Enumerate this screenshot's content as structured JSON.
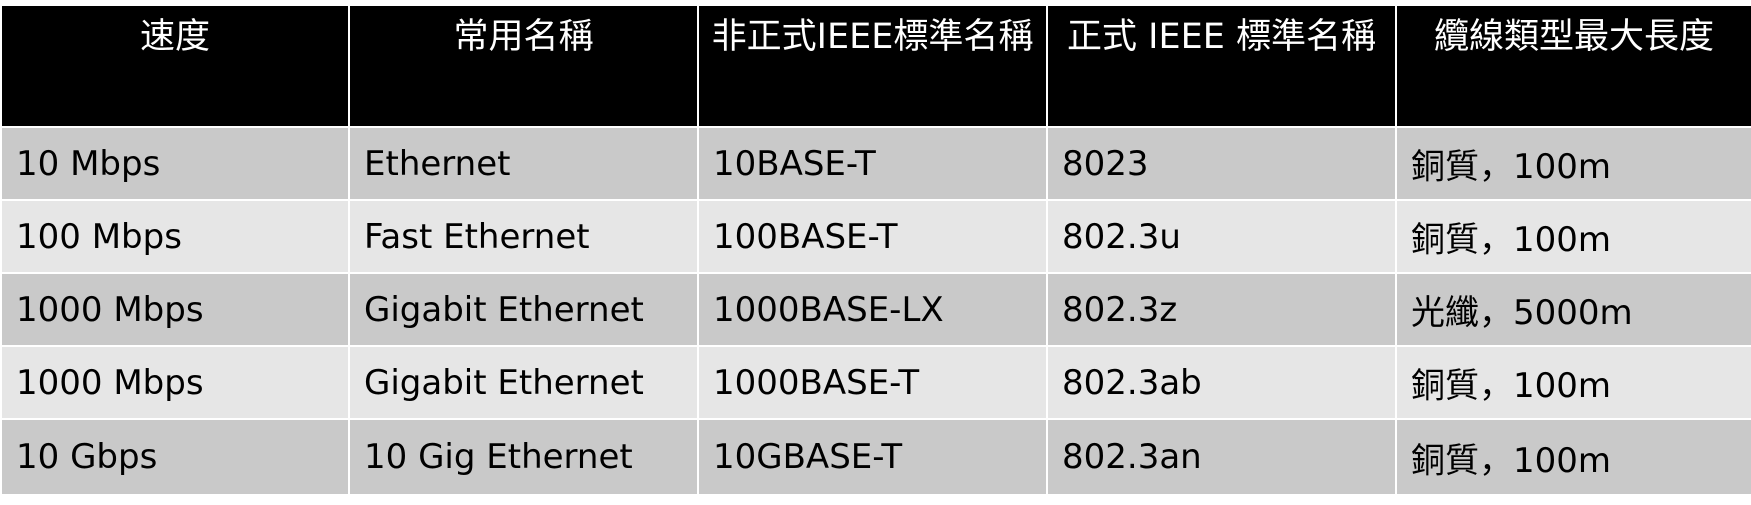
{
  "table": {
    "headers": [
      "速度",
      "常用名稱",
      "非正式IEEE標準名稱",
      "正式 IEEE 標準名稱",
      "纜線類型最大長度"
    ],
    "rows": [
      [
        "10 Mbps",
        "Ethernet",
        "10BASE-T",
        "8023",
        "銅質，100m"
      ],
      [
        "100 Mbps",
        "Fast Ethernet",
        "100BASE-T",
        "802.3u",
        "銅質，100m"
      ],
      [
        "1000 Mbps",
        "Gigabit Ethernet",
        "1000BASE-LX",
        "802.3z",
        "光纖，5000m"
      ],
      [
        "1000 Mbps",
        "Gigabit Ethernet",
        "1000BASE-T",
        "802.3ab",
        "銅質，100m"
      ],
      [
        "10 Gbps",
        "10 Gig Ethernet",
        "10GBASE-T",
        "802.3an",
        "銅質，100m"
      ]
    ]
  },
  "colors": {
    "header_background": "#000000",
    "header_text": "#ffffff",
    "row_dark": "#c9c9c9",
    "row_light": "#e6e6e6",
    "grid_lines": "#ffffff"
  }
}
